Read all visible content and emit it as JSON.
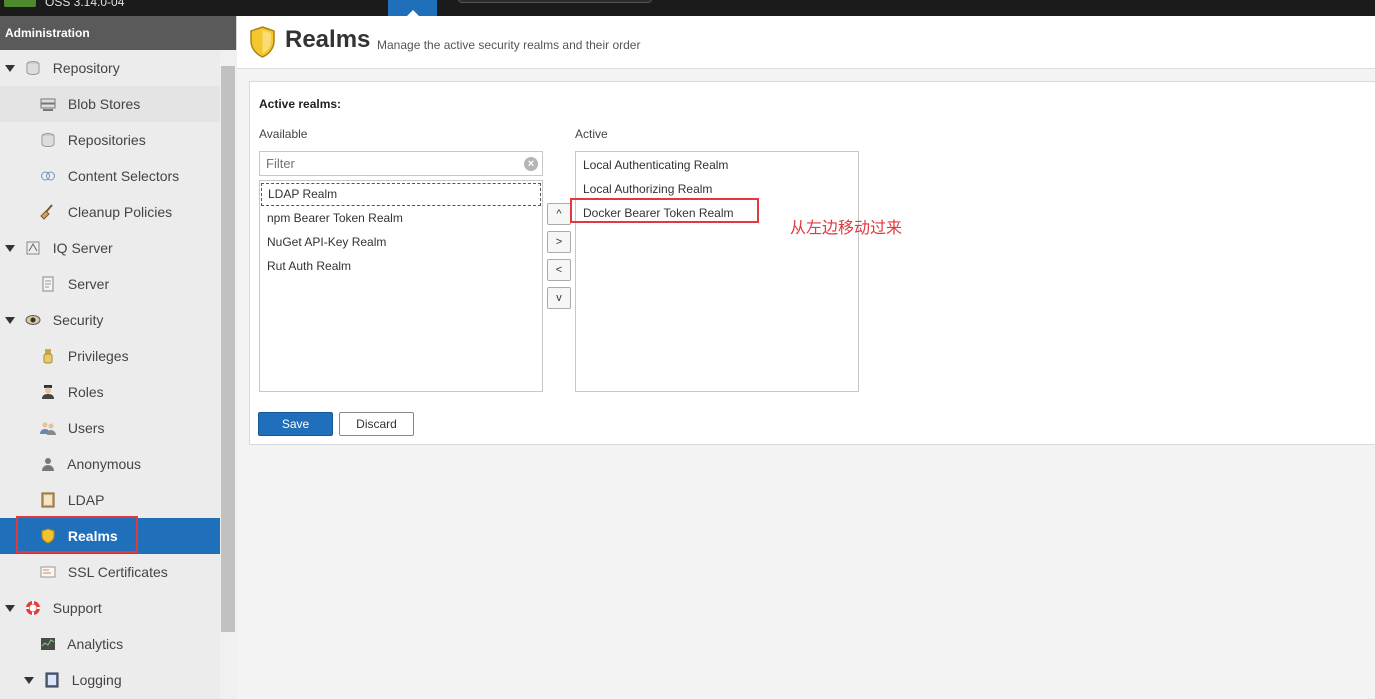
{
  "topbar": {
    "version": "OSS 3.14.0-04"
  },
  "sidebar": {
    "header": "Administration",
    "items": [
      {
        "label": "Repository",
        "kind": "group",
        "icon": "database-icon"
      },
      {
        "label": "Blob Stores",
        "kind": "sub",
        "icon": "server-icon"
      },
      {
        "label": "Repositories",
        "kind": "sub",
        "icon": "database-icon"
      },
      {
        "label": "Content Selectors",
        "kind": "sub",
        "icon": "selector-icon"
      },
      {
        "label": "Cleanup Policies",
        "kind": "sub",
        "icon": "broom-icon"
      },
      {
        "label": "IQ Server",
        "kind": "group",
        "icon": "iq-icon"
      },
      {
        "label": "Server",
        "kind": "sub",
        "icon": "document-icon"
      },
      {
        "label": "Security",
        "kind": "group",
        "icon": "eye-icon"
      },
      {
        "label": "Privileges",
        "kind": "sub",
        "icon": "medal-icon"
      },
      {
        "label": "Roles",
        "kind": "sub",
        "icon": "officer-icon"
      },
      {
        "label": "Users",
        "kind": "sub",
        "icon": "users-icon"
      },
      {
        "label": "Anonymous",
        "kind": "sub",
        "icon": "person-icon"
      },
      {
        "label": "LDAP",
        "kind": "sub",
        "icon": "book-icon"
      },
      {
        "label": "Realms",
        "kind": "sub",
        "icon": "shield-icon"
      },
      {
        "label": "SSL Certificates",
        "kind": "sub",
        "icon": "certificate-icon"
      },
      {
        "label": "Support",
        "kind": "group",
        "icon": "lifebuoy-icon"
      },
      {
        "label": "Analytics",
        "kind": "sub",
        "icon": "chart-icon"
      },
      {
        "label": "Logging",
        "kind": "group",
        "icon": "log-icon"
      }
    ]
  },
  "page": {
    "title": "Realms",
    "subtitle": "Manage the active security realms and their order"
  },
  "realms": {
    "section_title": "Active realms:",
    "available_label": "Available",
    "active_label": "Active",
    "filter_placeholder": "Filter",
    "available": [
      "LDAP Realm",
      "npm Bearer Token Realm",
      "NuGet API-Key Realm",
      "Rut Auth Realm"
    ],
    "active": [
      "Local Authenticating Realm",
      "Local Authorizing Realm",
      "Docker Bearer Token Realm"
    ],
    "move_buttons": [
      "^",
      ">",
      "<",
      "v"
    ],
    "save_label": "Save",
    "discard_label": "Discard"
  },
  "annotation": "从左边移动过来",
  "colors": {
    "accent": "#1f6fba",
    "highlight": "#e0393e"
  }
}
